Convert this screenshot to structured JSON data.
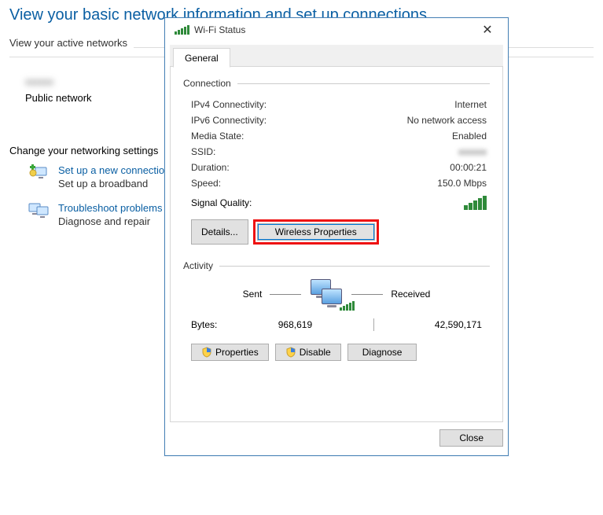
{
  "background": {
    "page_title": "View your basic network information and set up connections",
    "active_networks_label": "View your active networks",
    "network_name_blurred": "xxxxxx",
    "network_type": "Public network",
    "change_settings_label": "Change your networking settings",
    "setup_link": "Set up a new connection",
    "setup_desc": "Set up a broadband",
    "troubleshoot_link": "Troubleshoot problems",
    "troubleshoot_desc": "Diagnose and repair"
  },
  "dialog": {
    "title": "Wi-Fi Status",
    "tab_general": "General",
    "group_connection": "Connection",
    "rows": {
      "ipv4_k": "IPv4 Connectivity:",
      "ipv4_v": "Internet",
      "ipv6_k": "IPv6 Connectivity:",
      "ipv6_v": "No network access",
      "media_k": "Media State:",
      "media_v": "Enabled",
      "ssid_k": "SSID:",
      "ssid_v": "xxxxxx",
      "dur_k": "Duration:",
      "dur_v": "00:00:21",
      "speed_k": "Speed:",
      "speed_v": "150.0 Mbps",
      "sigq_k": "Signal Quality:"
    },
    "btn_details": "Details...",
    "btn_wireless_props": "Wireless Properties",
    "group_activity": "Activity",
    "sent_label": "Sent",
    "recv_label": "Received",
    "bytes_label": "Bytes:",
    "bytes_sent": "968,619",
    "bytes_recv": "42,590,171",
    "btn_properties": "Properties",
    "btn_disable": "Disable",
    "btn_diagnose": "Diagnose",
    "btn_close": "Close"
  }
}
